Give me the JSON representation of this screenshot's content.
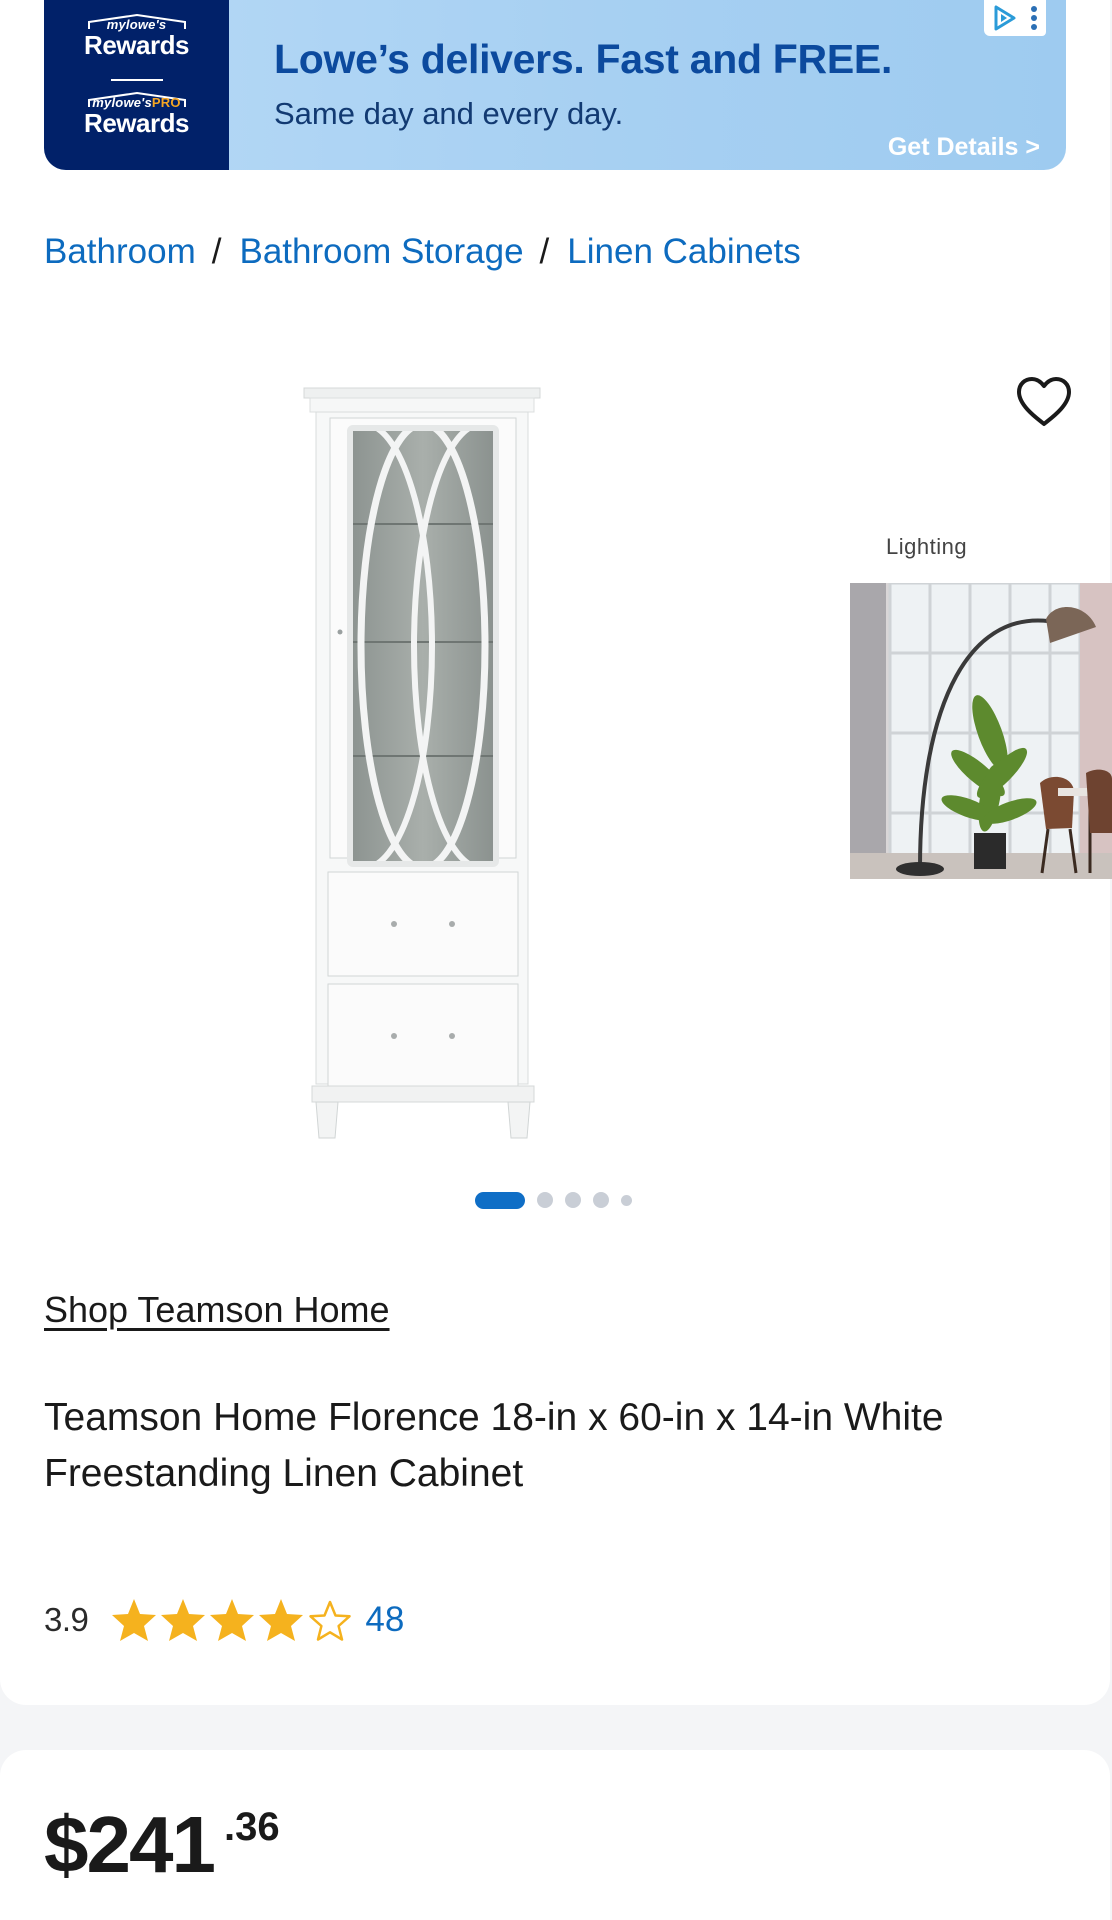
{
  "ad": {
    "logo_top_small": "mylowe's",
    "logo_top_big": "Rewards",
    "logo_bottom_small": "mylowe's",
    "logo_bottom_pro": "PRO",
    "logo_bottom_big": "Rewards",
    "headline": "Lowe’s delivers. Fast and FREE.",
    "subhead": "Same day and every day.",
    "cta": "Get Details >",
    "colors": {
      "logo_bg": "#012169",
      "banner_bg": "#a7d0f2",
      "headline": "#0c4a9e"
    }
  },
  "breadcrumb": {
    "items": [
      "Bathroom",
      "Bathroom Storage",
      "Linen Cabinets"
    ],
    "separator": "/"
  },
  "gallery": {
    "related_label": "Lighting",
    "slide_count": 5,
    "active_slide": 1,
    "favorite_icon": "heart-outline-icon"
  },
  "product": {
    "brand_link": "Shop Teamson Home",
    "title": "Teamson Home Florence 18-in x 60-in x 14-in White Freestanding Linen Cabinet",
    "rating": "3.9",
    "rating_value": 3.9,
    "rating_max": 5,
    "review_count": "48"
  },
  "price": {
    "dollars": "$241",
    "cents": ".36"
  },
  "colors": {
    "link": "#0d6bbf",
    "star": "#f5b21e",
    "carousel_active": "#0f6ec6"
  }
}
